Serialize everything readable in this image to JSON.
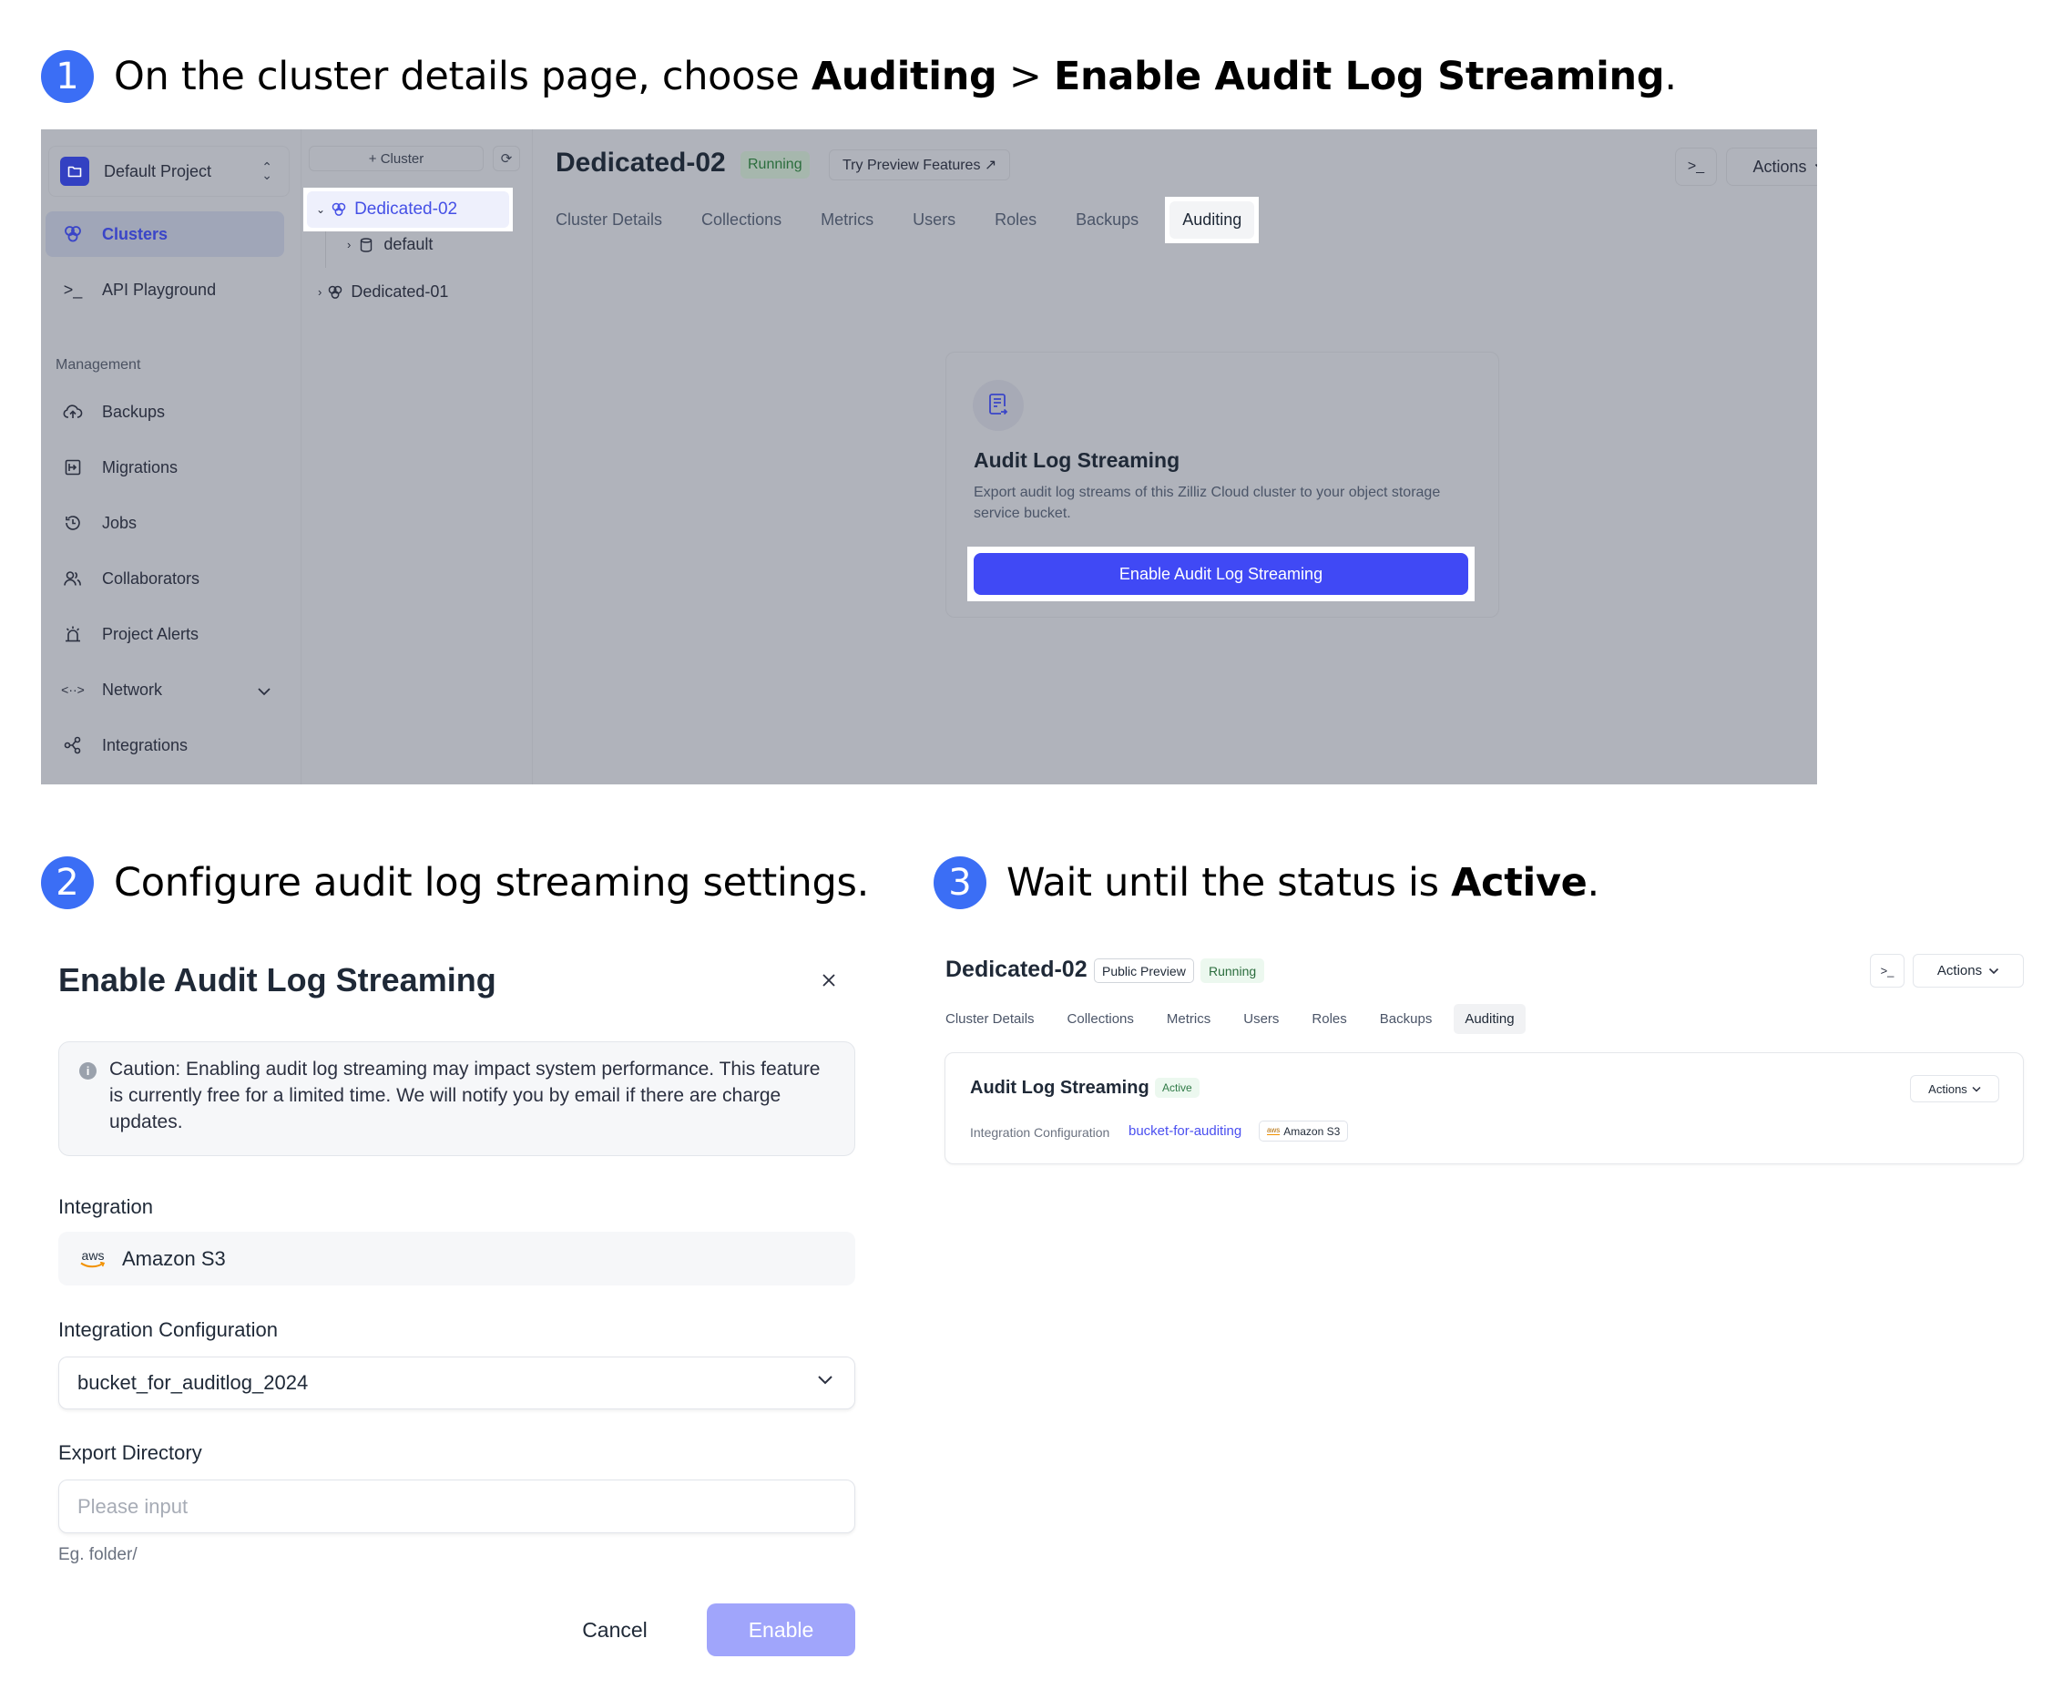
{
  "steps": [
    {
      "number": "1",
      "text_plain": "On the cluster details page, choose ",
      "bold1": "Auditing",
      "sep": " > ",
      "bold2": "Enable Audit Log Streaming",
      "end": "."
    },
    {
      "number": "2",
      "text_plain": "Configure audit log streaming settings."
    },
    {
      "number": "3",
      "text_plain": "Wait until the status is ",
      "bold1": "Active",
      "end": "."
    }
  ],
  "screen1": {
    "project": {
      "label": "Default Project"
    },
    "sidebar": {
      "items": [
        {
          "label": "Clusters",
          "icon": "clusters-icon",
          "active": true
        },
        {
          "label": "API Playground",
          "icon": "terminal-icon"
        }
      ],
      "section_label": "Management",
      "management_items": [
        {
          "label": "Backups",
          "icon": "cloud-upload-icon"
        },
        {
          "label": "Migrations",
          "icon": "migrate-icon"
        },
        {
          "label": "Jobs",
          "icon": "history-icon"
        },
        {
          "label": "Collaborators",
          "icon": "users-icon"
        },
        {
          "label": "Project Alerts",
          "icon": "alarm-icon"
        },
        {
          "label": "Network",
          "icon": "network-icon",
          "expandable": true
        },
        {
          "label": "Integrations",
          "icon": "share-icon"
        }
      ]
    },
    "tree": {
      "add_cluster_label": "+ Cluster",
      "items": [
        {
          "label": "Dedicated-02",
          "expanded": true,
          "selected": true
        },
        {
          "label": "default",
          "type": "database"
        },
        {
          "label": "Dedicated-01",
          "expanded": false
        }
      ]
    },
    "cluster": {
      "title": "Dedicated-02",
      "status": "Running",
      "preview_button": "Try Preview Features ↗",
      "terminal_label": ">_",
      "actions_label": "Actions",
      "tabs": [
        "Cluster Details",
        "Collections",
        "Metrics",
        "Users",
        "Roles",
        "Backups",
        "Auditing"
      ],
      "active_tab": "Auditing"
    },
    "card": {
      "title": "Audit Log Streaming",
      "description": "Export audit log streams of this Zilliz Cloud cluster to your object storage service bucket.",
      "button": "Enable Audit Log Streaming"
    }
  },
  "modal": {
    "title": "Enable Audit Log Streaming",
    "close_label": "×",
    "caution": "Caution: Enabling audit log streaming may impact system performance. This feature is currently free for a limited time. We will notify you by email if there are charge updates.",
    "integration_label": "Integration",
    "integration_value": "Amazon S3",
    "integration_logo_text": "aws",
    "config_label": "Integration Configuration",
    "config_value": "bucket_for_auditlog_2024",
    "export_label": "Export Directory",
    "export_placeholder": "Please input",
    "export_value": "",
    "export_hint": "Eg. folder/",
    "cancel_label": "Cancel",
    "enable_label": "Enable"
  },
  "screen3": {
    "title": "Dedicated-02",
    "preview_badge": "Public Preview",
    "status": "Running",
    "terminal_label": ">_",
    "actions_label": "Actions",
    "tabs": [
      "Cluster Details",
      "Collections",
      "Metrics",
      "Users",
      "Roles",
      "Backups",
      "Auditing"
    ],
    "active_tab": "Auditing",
    "card": {
      "title": "Audit Log Streaming",
      "status": "Active",
      "config_label": "Integration Configuration",
      "config_link": "bucket-for-auditing",
      "provider": "Amazon S3",
      "provider_logo_text": "aws",
      "actions_label": "Actions"
    }
  },
  "colors": {
    "accent": "#4049f5",
    "step_badge": "#3b6ef5",
    "overlay": "#b0b3bb",
    "running_text": "#2b6d3d",
    "link": "#4a4ff0",
    "disabled_button": "#a0a5fb"
  }
}
